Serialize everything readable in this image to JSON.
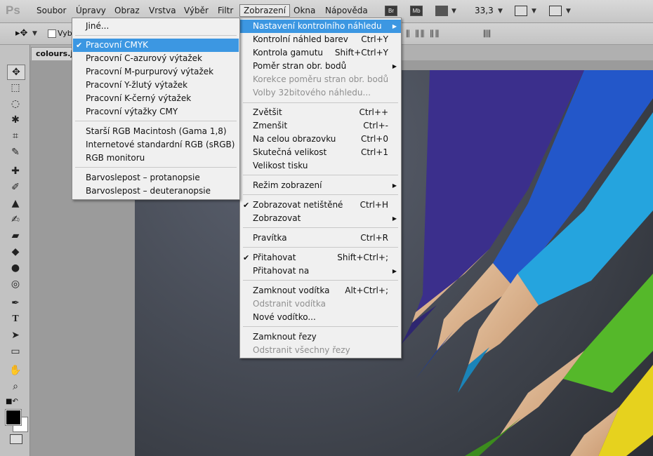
{
  "app": {
    "logo": "Ps"
  },
  "menubar": [
    {
      "label": "Soubor"
    },
    {
      "label": "Úpravy"
    },
    {
      "label": "Obraz"
    },
    {
      "label": "Vrstva"
    },
    {
      "label": "Výběr"
    },
    {
      "label": "Filtr"
    },
    {
      "label": "Zobrazení"
    },
    {
      "label": "Okna"
    },
    {
      "label": "Nápověda"
    }
  ],
  "appbar": {
    "br": "Br",
    "mb": "Mb",
    "zoom": "33,3"
  },
  "optionsbar": {
    "partial_label": "Vyb"
  },
  "document": {
    "tab_label": "colours.jpg"
  },
  "zobrazeni_menu": [
    {
      "label": "Nastavení kontrolního náhledu",
      "submenu": true,
      "highlighted": true
    },
    {
      "label": "Kontrolní náhled  barev",
      "shortcut": "Ctrl+Y"
    },
    {
      "label": "Kontrola gamutu",
      "shortcut": "Shift+Ctrl+Y"
    },
    {
      "label": "Poměr stran obr. bodů",
      "submenu": true
    },
    {
      "label": "Korekce poměru stran obr. bodů",
      "disabled": true
    },
    {
      "label": "Volby 32bitového náhledu...",
      "disabled": true
    },
    {
      "label": "Zvětšit",
      "shortcut": "Ctrl++"
    },
    {
      "label": "Zmenšit",
      "shortcut": "Ctrl+-"
    },
    {
      "label": "Na celou obrazovku",
      "shortcut": "Ctrl+0"
    },
    {
      "label": "Skutečná velikost",
      "shortcut": "Ctrl+1"
    },
    {
      "label": "Velikost tisku"
    },
    {
      "label": "Režim zobrazení",
      "submenu": true
    },
    {
      "label": "Zobrazovat netištěné",
      "shortcut": "Ctrl+H",
      "checked": true
    },
    {
      "label": "Zobrazovat",
      "submenu": true
    },
    {
      "label": "Pravítka",
      "shortcut": "Ctrl+R"
    },
    {
      "label": "Přitahovat",
      "shortcut": "Shift+Ctrl+;",
      "checked": true
    },
    {
      "label": "Přitahovat na",
      "submenu": true
    },
    {
      "label": "Zamknout vodítka",
      "shortcut": "Alt+Ctrl+;"
    },
    {
      "label": "Odstranit vodítka",
      "disabled": true
    },
    {
      "label": "Nové vodítko..."
    },
    {
      "label": "Zamknout řezy"
    },
    {
      "label": "Odstranit všechny řezy",
      "disabled": true
    }
  ],
  "proof_submenu": [
    {
      "label": "Jiné..."
    },
    {
      "label": "Pracovní CMYK",
      "checked": true,
      "highlighted": true
    },
    {
      "label": "Pracovní C-azurový výtažek"
    },
    {
      "label": "Pracovní M-purpurový výtažek"
    },
    {
      "label": "Pracovní Y-žlutý výtažek"
    },
    {
      "label": "Pracovní K-černý výtažek"
    },
    {
      "label": "Pracovní výtažky CMY"
    },
    {
      "label": "Starší RGB Macintosh (Gama 1,8)"
    },
    {
      "label": "Internetové standardní RGB (sRGB)"
    },
    {
      "label": "RGB monitoru"
    },
    {
      "label": "Barvoslepost – protanopsie"
    },
    {
      "label": "Barvoslepost – deuteranopsie"
    }
  ],
  "glyphs": {
    "check": "✔",
    "submenu_arrow": "▶",
    "dropdown_caret": "▼"
  },
  "colors": {
    "highlight": "#3c97e2",
    "foreground": "#000000",
    "background": "#ffffff"
  }
}
